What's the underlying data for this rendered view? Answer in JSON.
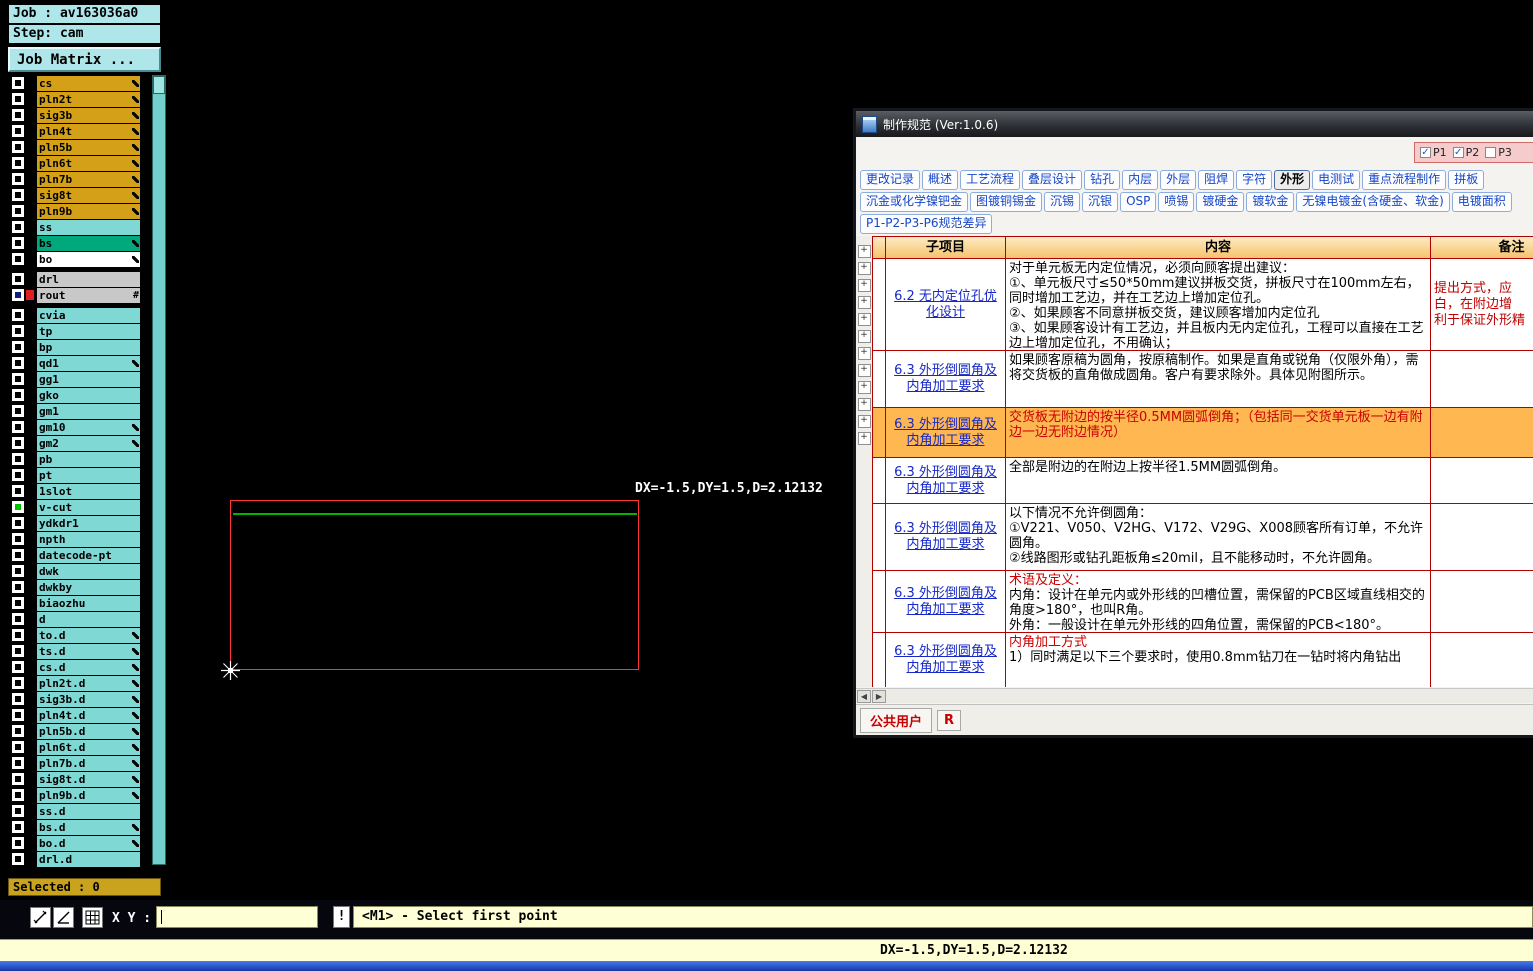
{
  "colors": {
    "layer_gold": "#D4A017",
    "layer_cyan": "#7FD8D4",
    "layer_teal": "#00A87C",
    "layer_white": "#FFFFFF",
    "layer_silver": "#C8C8C8",
    "rout_chip_red": "#E02020",
    "vcut_green": "#00C000",
    "panel_cyan": "#AEE6EA",
    "selected_bar_gold": "#C9A21E",
    "prompt_yellow": "#FFFFD6",
    "table_border_red": "#B00000",
    "header_orange": "#F5C36C",
    "highlight_orange": "#FFB752",
    "red_text": "#C00000",
    "link_blue": "#1628C8"
  },
  "icons": {
    "tree_expand": "+",
    "checkbox_check": "✓",
    "scroll_left": "◀",
    "scroll_right": "▶"
  },
  "job_panel": {
    "job_label": "Job : av163036a0",
    "step_label": "Step: cam",
    "matrix_button": "Job Matrix ...",
    "selected_label": "Selected : 0"
  },
  "layers": [
    {
      "name": "cs",
      "color": "#D4A017",
      "marker": "pencil"
    },
    {
      "name": "pln2t",
      "color": "#D4A017",
      "marker": "pencil"
    },
    {
      "name": "sig3b",
      "color": "#D4A017",
      "marker": "pencil"
    },
    {
      "name": "pln4t",
      "color": "#D4A017",
      "marker": "pencil"
    },
    {
      "name": "pln5b",
      "color": "#D4A017",
      "marker": "pencil"
    },
    {
      "name": "pln6t",
      "color": "#D4A017",
      "marker": "pencil"
    },
    {
      "name": "pln7b",
      "color": "#D4A017",
      "marker": "pencil"
    },
    {
      "name": "sig8t",
      "color": "#D4A017",
      "marker": "pencil"
    },
    {
      "name": "pln9b",
      "color": "#D4A017",
      "marker": "pencil"
    },
    {
      "name": "ss",
      "color": "#7FD8D4"
    },
    {
      "name": "bs",
      "color": "#00A87C",
      "marker": "pencil"
    },
    {
      "name": "bo",
      "color": "#FFFFFF",
      "marker": "pencil"
    },
    {
      "name": "drl",
      "color": "#C8C8C8",
      "gap": true
    },
    {
      "name": "rout",
      "color": "#C8C8C8",
      "marker": "hash",
      "chip": "#E02020",
      "check": "#102080"
    },
    {
      "name": "cvia",
      "color": "#7FD8D4",
      "gap": true
    },
    {
      "name": "tp",
      "color": "#7FD8D4"
    },
    {
      "name": "bp",
      "color": "#7FD8D4"
    },
    {
      "name": "qd1",
      "color": "#7FD8D4",
      "marker": "pencil"
    },
    {
      "name": "gg1",
      "color": "#7FD8D4"
    },
    {
      "name": "gko",
      "color": "#7FD8D4"
    },
    {
      "name": "gm1",
      "color": "#7FD8D4"
    },
    {
      "name": "gm10",
      "color": "#7FD8D4",
      "marker": "pencil"
    },
    {
      "name": "gm2",
      "color": "#7FD8D4",
      "marker": "pencil"
    },
    {
      "name": "pb",
      "color": "#7FD8D4"
    },
    {
      "name": "pt",
      "color": "#7FD8D4"
    },
    {
      "name": "1slot",
      "color": "#7FD8D4"
    },
    {
      "name": "v-cut",
      "color": "#7FD8D4",
      "check": "#00C000"
    },
    {
      "name": "ydkdr1",
      "color": "#7FD8D4"
    },
    {
      "name": "npth",
      "color": "#7FD8D4"
    },
    {
      "name": "datecode-pt",
      "color": "#7FD8D4"
    },
    {
      "name": "dwk",
      "color": "#7FD8D4"
    },
    {
      "name": "dwkby",
      "color": "#7FD8D4"
    },
    {
      "name": "biaozhu",
      "color": "#7FD8D4"
    },
    {
      "name": "d",
      "color": "#7FD8D4"
    },
    {
      "name": "to.d",
      "color": "#7FD8D4",
      "marker": "pencil"
    },
    {
      "name": "ts.d",
      "color": "#7FD8D4",
      "marker": "pencil"
    },
    {
      "name": "cs.d",
      "color": "#7FD8D4",
      "marker": "pencil"
    },
    {
      "name": "pln2t.d",
      "color": "#7FD8D4",
      "marker": "pencil"
    },
    {
      "name": "sig3b.d",
      "color": "#7FD8D4",
      "marker": "pencil"
    },
    {
      "name": "pln4t.d",
      "color": "#7FD8D4",
      "marker": "pencil"
    },
    {
      "name": "pln5b.d",
      "color": "#7FD8D4",
      "marker": "pencil"
    },
    {
      "name": "pln6t.d",
      "color": "#7FD8D4",
      "marker": "pencil"
    },
    {
      "name": "pln7b.d",
      "color": "#7FD8D4",
      "marker": "pencil"
    },
    {
      "name": "sig8t.d",
      "color": "#7FD8D4",
      "marker": "pencil"
    },
    {
      "name": "pln9b.d",
      "color": "#7FD8D4",
      "marker": "pencil"
    },
    {
      "name": "ss.d",
      "color": "#7FD8D4"
    },
    {
      "name": "bs.d",
      "color": "#7FD8D4",
      "marker": "pencil"
    },
    {
      "name": "bo.d",
      "color": "#7FD8D4",
      "marker": "pencil"
    },
    {
      "name": "drl.d",
      "color": "#7FD8D4"
    }
  ],
  "canvas": {
    "measure_label": "DX=-1.5,DY=1.5,D=2.12132"
  },
  "toolbar": {
    "xy_label": "X Y :",
    "input_value": "",
    "alert_button": "!",
    "prompt": "<M1> - Select first point"
  },
  "status_bar": {
    "text": "DX=-1.5,DY=1.5,D=2.12132"
  },
  "spec_window": {
    "title": "制作规范 (Ver:1.0.6)",
    "page_checks": [
      {
        "label": "P1",
        "checked": true
      },
      {
        "label": "P2",
        "checked": true
      },
      {
        "label": "P3",
        "checked": false
      }
    ],
    "tabs_row1": [
      "更改记录",
      "概述",
      "工艺流程",
      "叠层设计",
      "钻孔",
      "内层",
      "外层",
      "阻焊",
      "字符",
      "外形",
      "电测试",
      "重点流程制作",
      "拼板"
    ],
    "active_tab": "外形",
    "tabs_row2": [
      "沉金或化学镍钯金",
      "图镀铜锡金",
      "沉锡",
      "沉银",
      "OSP",
      "喷锡",
      "镀硬金",
      "镀软金",
      "无镍电镀金(含硬金、软金)",
      "电镀面积"
    ],
    "tabs_row3": [
      "P1-P2-P3-P6规范差异"
    ],
    "tree_expanders": 12,
    "table": {
      "headers": [
        "子项目",
        "内容",
        "备注"
      ],
      "rows": [
        {
          "item": "6.2 无内定位孔优化设计",
          "content": [
            {
              "text": "对于单元板无内定位情况，必须向顾客提出建议：\n①、单元板尺寸≤50*50mm建议拼板交货，拼板尺寸在100mm左右，同时增加工艺边，并在工艺边上增加定位孔。\n②、如果顾客不同意拼板交货，建议顾客增加内定位孔\n③、如果顾客设计有工艺边，并且板内无内定位孔，工程可以直接在工艺边上增加定位孔，不用确认；",
              "red": false
            }
          ],
          "remark": "提出方式，应\n白，在附边增\n利于保证外形精",
          "highlight": false
        },
        {
          "item": "6.3 外形倒圆角及内角加工要求",
          "content": [
            {
              "text": "如果顾客原稿为圆角，按原稿制作。如果是直角或锐角（仅限外角），需将交货板的直角做成圆角。客户有要求除外。具体见附图所示。",
              "red": false
            }
          ],
          "remark": "",
          "highlight": false
        },
        {
          "item": "6.3 外形倒圆角及内角加工要求",
          "content": [
            {
              "text": "交货板无附边的按半径0.5MM圆弧倒角；（包括同一交货单元板一边有附边一边无附边情况）",
              "red": true
            }
          ],
          "remark": "",
          "highlight": true
        },
        {
          "item": "6.3 外形倒圆角及内角加工要求",
          "content": [
            {
              "text": "全部是附边的在附边上按半径1.5MM圆弧倒角。",
              "red": false
            }
          ],
          "remark": "",
          "highlight": false
        },
        {
          "item": "6.3 外形倒圆角及内角加工要求",
          "content": [
            {
              "text": "以下情况不允许倒圆角：\n①V221、V050、V2HG、V172、V29G、X008顾客所有订单，不允许圆角。\n②线路图形或钻孔距板角≤20mil，且不能移动时，不允许圆角。",
              "red": false
            }
          ],
          "remark": "",
          "highlight": false
        },
        {
          "item": "6.3 外形倒圆角及内角加工要求",
          "content": [
            {
              "text": "术语及定义：\n",
              "red": true
            },
            {
              "text": "内角：设计在单元内或外形线的凹槽位置，需保留的PCB区域直线相交的角度>180°，也叫R角。\n外角：一般设计在单元外形线的四角位置，需保留的PCB<180°。",
              "red": false
            }
          ],
          "remark": "",
          "highlight": false
        },
        {
          "item": "6.3 外形倒圆角及内角加工要求",
          "content": [
            {
              "text": "内角加工方式\n",
              "red": true
            },
            {
              "text": "1）同时满足以下三个要求时，使用0.8mm钻刀在一钻时将内角钻出",
              "red": false
            }
          ],
          "remark": "",
          "highlight": false
        }
      ]
    },
    "footer": {
      "user_button": "公共用户",
      "r_button": "R"
    }
  }
}
